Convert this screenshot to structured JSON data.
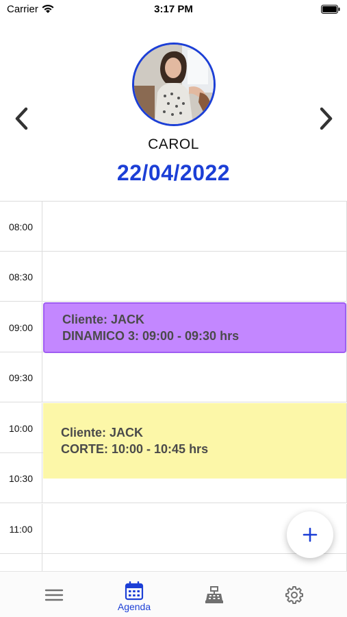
{
  "status_bar": {
    "carrier": "Carrier",
    "time": "3:17 PM",
    "icons": [
      "wifi-icon",
      "battery-icon"
    ]
  },
  "header": {
    "professional_name": "CAROL",
    "date": "22/04/2022",
    "avatar": "professional-avatar",
    "prev_icon": "chevron-left-icon",
    "next_icon": "chevron-right-icon"
  },
  "schedule": {
    "slots": [
      "08:00",
      "08:30",
      "09:00",
      "09:30",
      "10:00",
      "10:30",
      "11:00"
    ],
    "appointments": [
      {
        "client_line": "Cliente: JACK",
        "service_line": "DINAMICO 3:  09:00 - 09:30 hrs",
        "color": "#c387ff",
        "border_color": "#9f5cf2"
      },
      {
        "client_line": "Cliente: JACK",
        "service_line": "CORTE:  10:00 - 10:45 hrs",
        "color": "#fcf7a8"
      }
    ]
  },
  "fab": {
    "icon": "plus-icon"
  },
  "tab_bar": {
    "tabs": [
      {
        "icon": "menu-icon",
        "label": ""
      },
      {
        "icon": "calendar-icon",
        "label": "Agenda",
        "active": true
      },
      {
        "icon": "cash-register-icon",
        "label": ""
      },
      {
        "icon": "gear-icon",
        "label": ""
      }
    ]
  },
  "colors": {
    "accent": "#1c3fd6",
    "inactive_icon": "#707070",
    "grid_line": "#dcdcdc"
  }
}
